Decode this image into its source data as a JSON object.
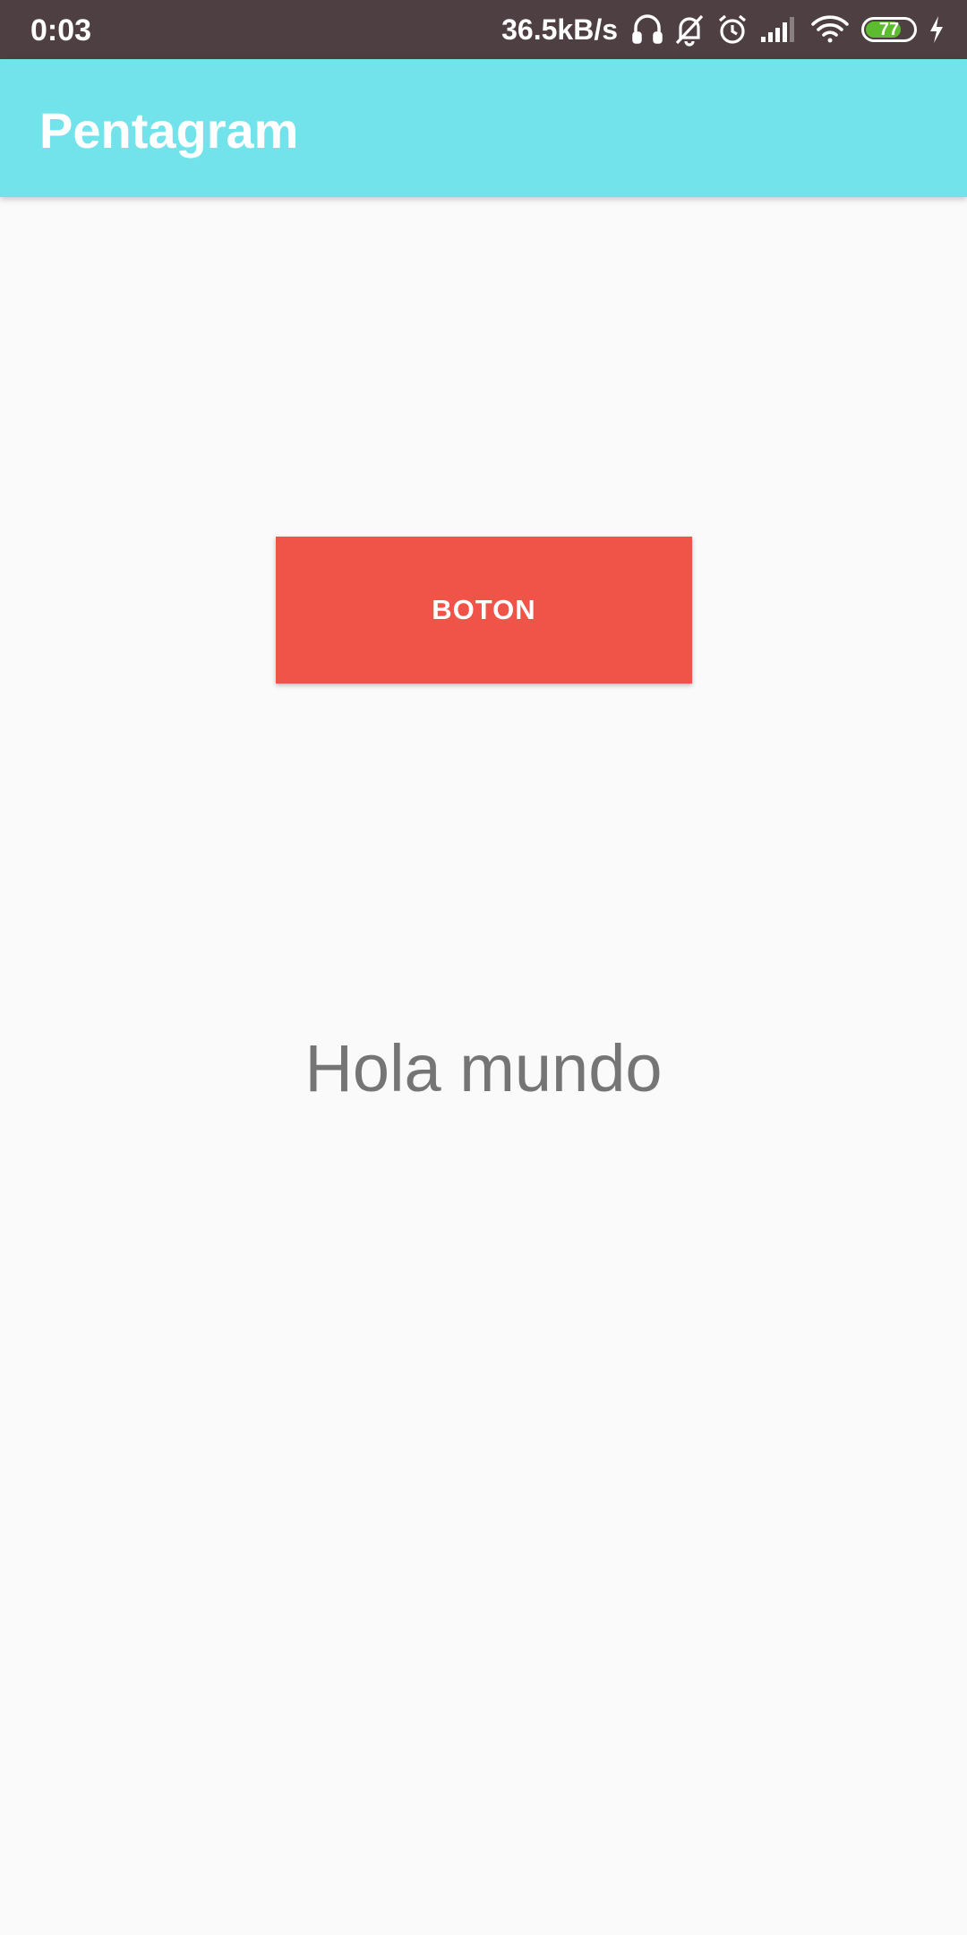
{
  "status_bar": {
    "time": "0:03",
    "net_speed": "36.5kB/s",
    "battery_level": "77",
    "battery_fraction": 0.77,
    "icons": [
      "headset-icon",
      "bell-off-icon",
      "alarm-icon",
      "signal-icon",
      "wifi-icon",
      "battery-icon",
      "charging-icon"
    ],
    "background_color": "#4e3f42"
  },
  "app_bar": {
    "title": "Pentagram",
    "background_color": "#72e3ea"
  },
  "main": {
    "button_label": "BOTON",
    "button_color": "#f05347",
    "hello_text": "Hola mundo"
  }
}
